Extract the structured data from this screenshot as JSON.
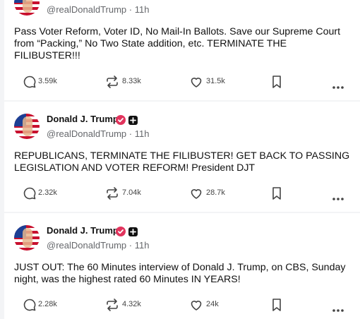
{
  "posts": [
    {
      "name": "",
      "handle": "@realDonaldTrump",
      "time": "11h",
      "text": "Pass Voter Reform, Voter ID, No Mail-In Ballots. Save our Supreme Court from “Packing,” No Two State addition, etc. TERMINATE THE FILIBUSTER!!!",
      "replies": "3.59k",
      "reposts": "8.33k",
      "likes": "31.5k"
    },
    {
      "name": "Donald J. Trump",
      "handle": "@realDonaldTrump",
      "time": "11h",
      "text": "REPUBLICANS, TERMINATE THE FILIBUSTER! GET BACK TO PASSING LEGISLATION AND VOTER REFORM! President DJT",
      "replies": "2.32k",
      "reposts": "7.04k",
      "likes": "28.7k"
    },
    {
      "name": "Donald J. Trump",
      "handle": "@realDonaldTrump",
      "time": "11h",
      "text": "JUST OUT: The 60 Minutes interview of Donald J. Trump, on CBS, Sunday night, was the highest rated 60 Minutes IN YEARS!",
      "replies": "2.28k",
      "reposts": "4.32k",
      "likes": "24k"
    }
  ],
  "separator": "·",
  "colors": {
    "verified": "#e2345d",
    "text": "#111111",
    "muted": "#65676b",
    "background": "#f3f4f6"
  },
  "icons": {
    "reply": "speech-bubble-icon",
    "repost": "repost-arrows-icon",
    "like": "heart-icon",
    "bookmark": "bookmark-icon",
    "more": "more-dots-icon"
  }
}
